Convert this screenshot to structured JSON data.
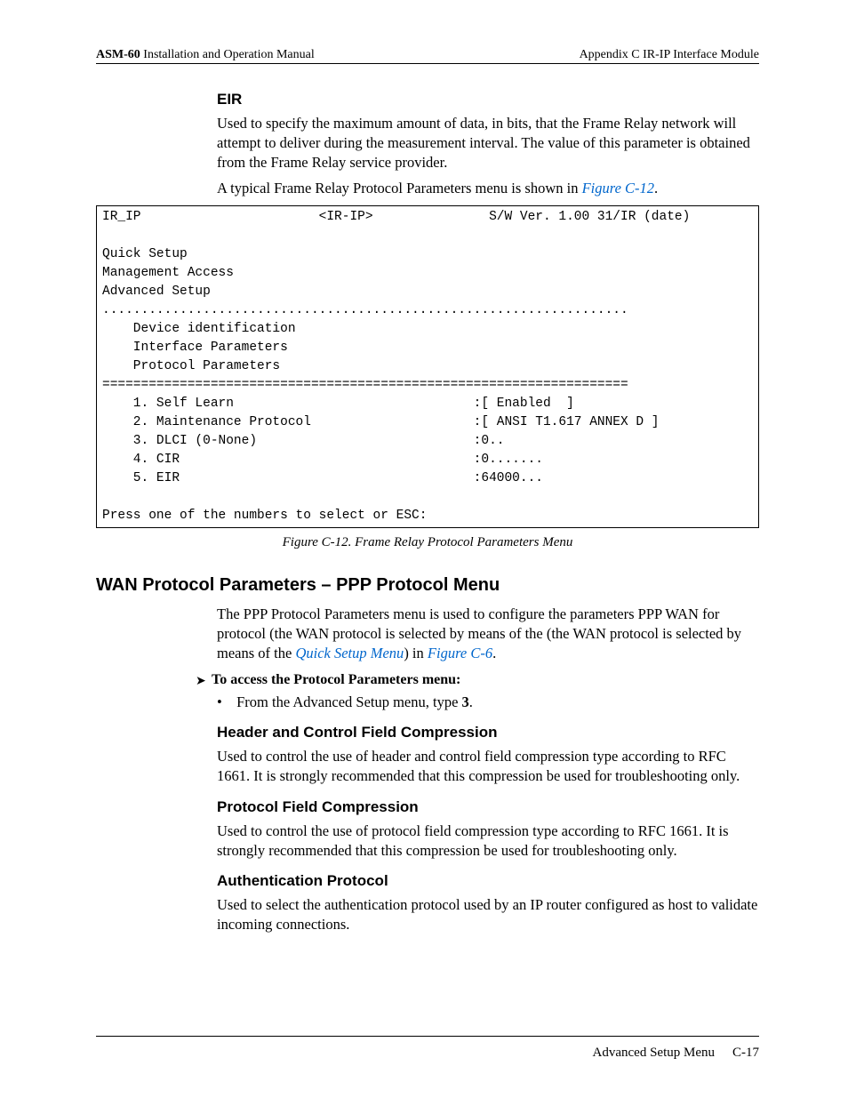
{
  "header": {
    "left_bold": "ASM-60",
    "left_rest": " Installation and Operation Manual",
    "right": "Appendix C  IR-IP Interface Module"
  },
  "eir": {
    "title": "EIR",
    "para": "Used to specify the maximum amount of data, in bits, that the Frame Relay network will attempt to deliver during the measurement interval. The value of this parameter is obtained from the Frame Relay service provider."
  },
  "intro_line_a": "A typical Frame Relay Protocol Parameters menu is shown in ",
  "intro_link": "Figure C-12",
  "intro_line_b": ".",
  "terminal": "IR_IP                       <IR-IP>               S/W Ver. 1.00 31/IR (date)\n\nQuick Setup\nManagement Access\nAdvanced Setup\n....................................................................\n    Device identification\n    Interface Parameters\n    Protocol Parameters\n====================================================================\n    1. Self Learn                               :[ Enabled  ]\n    2. Maintenance Protocol                     :[ ANSI T1.617 ANNEX D ]\n    3. DLCI (0-None)                            :0..\n    4. CIR                                      :0.......\n    5. EIR                                      :64000...\n\nPress one of the numbers to select or ESC:",
  "fig_caption": "Figure C-12.  Frame Relay Protocol Parameters Menu",
  "h2": "WAN Protocol Parameters – PPP Protocol Menu",
  "ppp_para_a": "The PPP Protocol Parameters menu is used to configure the parameters PPP WAN for protocol (the WAN protocol is selected by means of the (the WAN protocol is selected by means of the ",
  "ppp_link1": "Quick Setup Menu",
  "ppp_para_b": ") in ",
  "ppp_link2": "Figure C-6",
  "ppp_para_c": ".",
  "access": {
    "title": "To access the Protocol Parameters menu:",
    "bullet_a": "From the Advanced Setup menu, type ",
    "bullet_bold": "3",
    "bullet_b": "."
  },
  "hcfc": {
    "title": "Header and Control Field Compression",
    "para": "Used to control the use of header and control field compression type according to RFC 1661. It is strongly recommended that this compression be used for troubleshooting only."
  },
  "pfc": {
    "title": "Protocol Field Compression",
    "para": "Used to control the use of protocol field compression type according to RFC 1661. It is strongly recommended that this compression be used for troubleshooting only."
  },
  "auth": {
    "title": "Authentication Protocol",
    "para": "Used to select the authentication protocol used by an IP router configured as host to validate incoming connections."
  },
  "footer": {
    "section": "Advanced Setup Menu",
    "page": "C-17"
  }
}
